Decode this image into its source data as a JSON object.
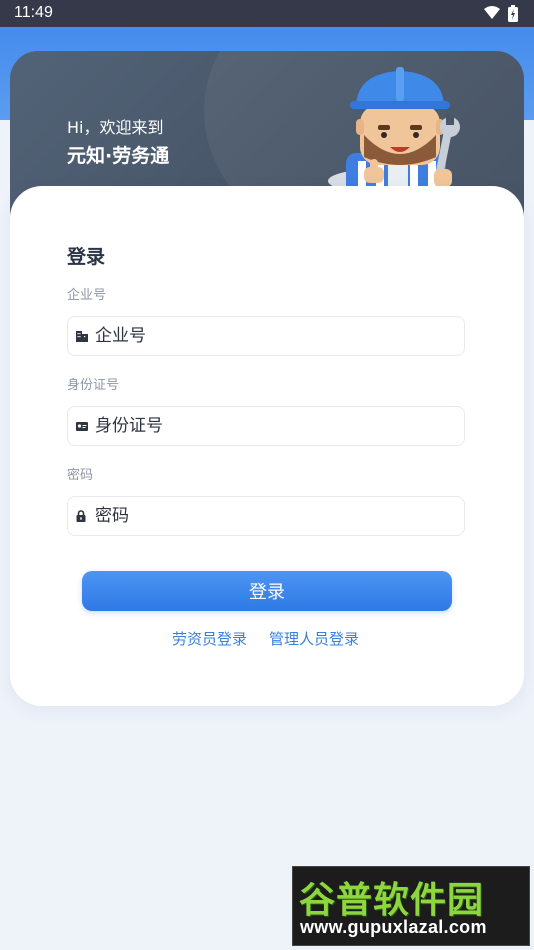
{
  "status_bar": {
    "time": "11:49"
  },
  "hero": {
    "greeting": "Hi，欢迎来到",
    "app_name": "元知·劳务通"
  },
  "login_form": {
    "title": "登录",
    "fields": [
      {
        "label": "企业号",
        "placeholder": "企业号",
        "icon": "building-icon"
      },
      {
        "label": "身份证号",
        "placeholder": "身份证号",
        "icon": "id-card-icon"
      },
      {
        "label": "密码",
        "placeholder": "密码",
        "icon": "lock-icon"
      }
    ],
    "submit_label": "登录",
    "alt_links": [
      "劳资员登录",
      "管理人员登录"
    ]
  },
  "watermark": {
    "text": "谷普软件园",
    "url": "www.gupuxlazal.com"
  },
  "colors": {
    "primary": "#3b82eb",
    "hero_bg": "#4a5668",
    "page_bg": "#eef2f9",
    "link": "#3b7fd9"
  }
}
